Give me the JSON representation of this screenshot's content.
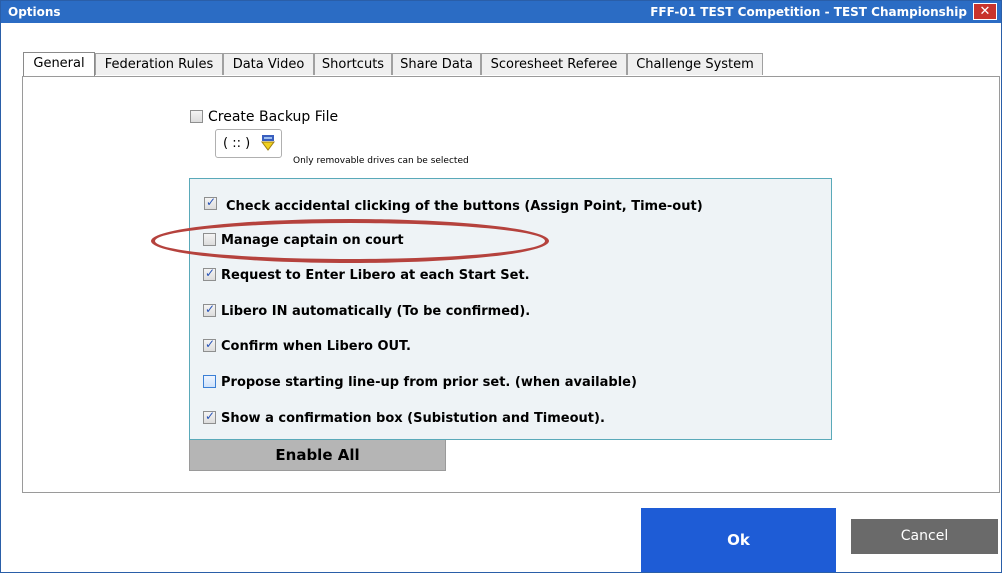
{
  "titlebar": {
    "left": "Options",
    "right": "FFF-01  TEST Competition - TEST Championship",
    "close_glyph": "✕"
  },
  "tabs": [
    {
      "label": "General",
      "active": true
    },
    {
      "label": "Federation Rules"
    },
    {
      "label": "Data Video"
    },
    {
      "label": "Shortcuts"
    },
    {
      "label": "Share Data"
    },
    {
      "label": "Scoresheet Referee"
    },
    {
      "label": "Challenge System"
    }
  ],
  "backup": {
    "label": "Create Backup File",
    "checked": false,
    "drive_value": "( :: )",
    "drive_icon": "usb-drive-icon",
    "note": "Only removable drives can be selected"
  },
  "options": [
    {
      "label": "Check accidental clicking of the buttons (Assign Point, Time-out)",
      "checked": true
    },
    {
      "label": "Manage captain on court",
      "checked": false,
      "highlighted": true
    },
    {
      "label": "Request to Enter Libero at each Start Set.",
      "checked": true
    },
    {
      "label": "Libero IN automatically (To be confirmed).",
      "checked": true
    },
    {
      "label": "Confirm when Libero OUT.",
      "checked": true
    },
    {
      "label": "Propose starting line-up from prior set. (when available)",
      "checked": false
    },
    {
      "label": "Show a confirmation box (Subistution and Timeout).",
      "checked": true
    }
  ],
  "enable_all_label": "Enable All",
  "footer": {
    "ok_label": "Ok",
    "cancel_label": "Cancel"
  },
  "colors": {
    "titlebar": "#2b6cc4",
    "ok": "#1e5cd6",
    "cancel": "#6a6a6a",
    "highlight": "#b5423d"
  }
}
